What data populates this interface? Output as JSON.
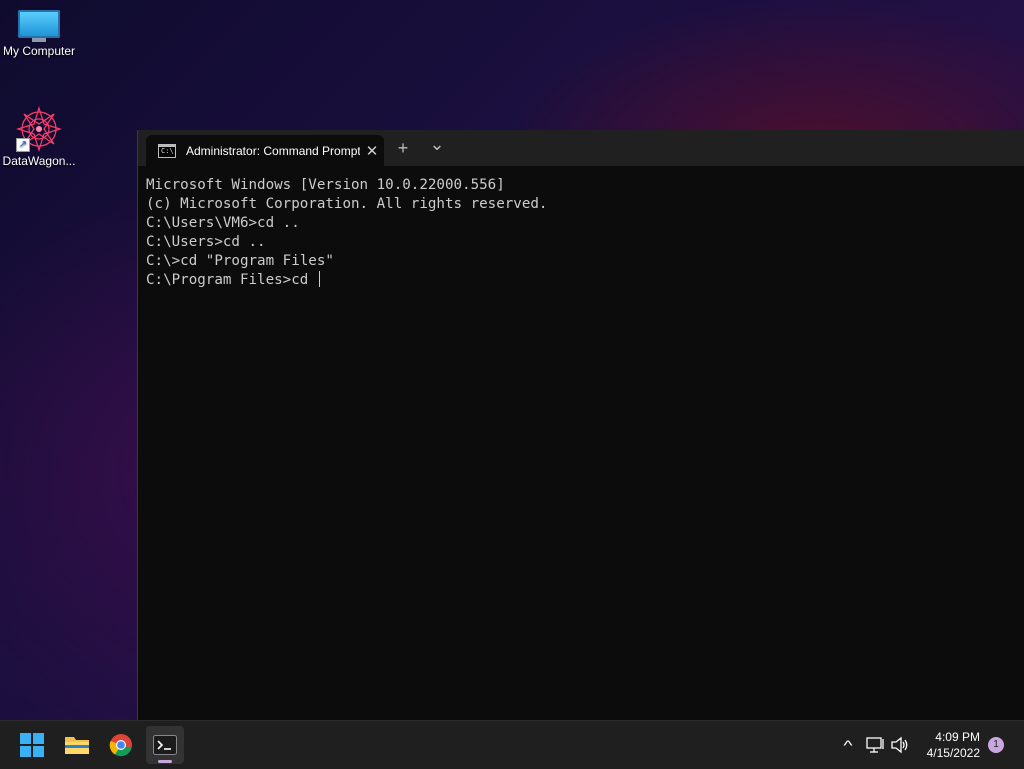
{
  "desktop": {
    "icons": [
      {
        "label": "My Computer",
        "icon": "monitor-icon"
      },
      {
        "label": "DataWagon...",
        "icon": "datawagon-logo-icon"
      }
    ]
  },
  "terminal": {
    "tab_title": "Administrator: Command Prompt",
    "cmd_icon_text": "C:\\",
    "new_tab_glyph": "+",
    "dropdown_glyph": "⌄",
    "close_glyph": "✕",
    "lines": [
      "Microsoft Windows [Version 10.0.22000.556]",
      "(c) Microsoft Corporation. All rights reserved.",
      "",
      "C:\\Users\\VM6>cd ..",
      "",
      "C:\\Users>cd ..",
      "",
      "C:\\>cd \"Program Files\"",
      "",
      "C:\\Program Files>cd "
    ]
  },
  "taskbar": {
    "apps": [
      {
        "name": "start-button",
        "icon": "windows-logo-icon"
      },
      {
        "name": "file-explorer",
        "icon": "folder-icon"
      },
      {
        "name": "chrome",
        "icon": "chrome-icon"
      },
      {
        "name": "terminal",
        "icon": "terminal-icon",
        "active": true
      }
    ],
    "time": "4:09 PM",
    "date": "4/15/2022",
    "notification_count": "1",
    "tray_chevron": "^"
  }
}
